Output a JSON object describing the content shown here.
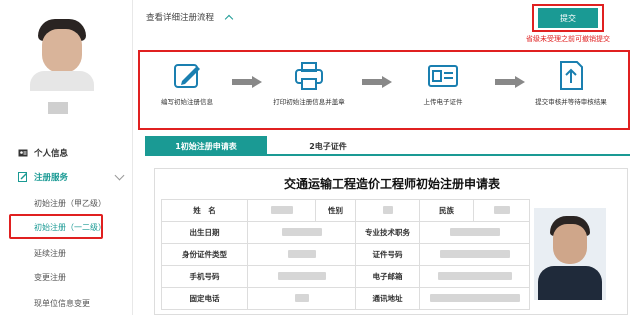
{
  "sidebar": {
    "personal_info": "个人信息",
    "reg_service": "注册服务",
    "sub_items": [
      "初始注册（甲乙级）",
      "初始注册（一二级）",
      "延续注册",
      "变更注册",
      "现单位信息变更"
    ],
    "selected_index": 1
  },
  "header": {
    "flow_link": "查看详细注册流程",
    "submit_label": "提交",
    "submit_note": "省级未受理之前可撤销提交"
  },
  "steps": [
    {
      "label": "编写初始注册信息",
      "icon": "edit-icon"
    },
    {
      "label": "打印初始注册信息并盖章",
      "icon": "printer-icon"
    },
    {
      "label": "上传电子证件",
      "icon": "id-card-icon"
    },
    {
      "label": "提交审核并等待审核结果",
      "icon": "upload-icon"
    }
  ],
  "tabs": [
    "1初始注册申请表",
    "2电子证件"
  ],
  "form": {
    "title": "交通运输工程造价工程师初始注册申请表",
    "labels": {
      "name": "姓　名",
      "gender": "性别",
      "ethnicity": "民族",
      "birth": "出生日期",
      "title_tech": "专业技术职务",
      "id_type": "身份证件类型",
      "id_no": "证件号码",
      "mobile": "手机号码",
      "email": "电子邮箱",
      "phone": "固定电话",
      "address": "通讯地址"
    }
  },
  "colors": {
    "accent": "#1a9a94",
    "highlight": "#e02020"
  }
}
